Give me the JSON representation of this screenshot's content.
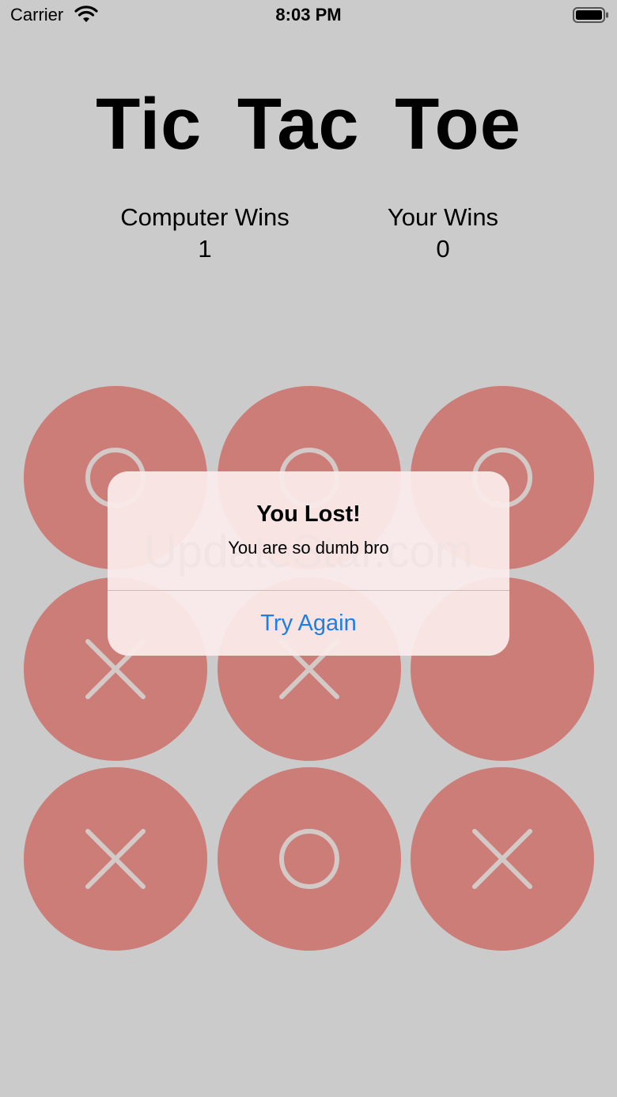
{
  "status_bar": {
    "carrier": "Carrier",
    "time": "8:03 PM",
    "wifi_icon": "wifi-icon",
    "battery_icon": "battery-icon"
  },
  "title": "Tic Tac Toe",
  "scores": {
    "computer": {
      "label": "Computer Wins",
      "value": "1"
    },
    "user": {
      "label": "Your Wins",
      "value": "0"
    }
  },
  "board": {
    "cell_color": "#cd7d77",
    "mark_color": "#d3c9c7",
    "cells": [
      "O",
      "O",
      "O",
      "X",
      "X",
      "",
      "X",
      "O",
      "X"
    ]
  },
  "alert": {
    "title": "You Lost!",
    "message": "You are so dumb bro",
    "button_label": "Try Again",
    "button_color": "#1a7fe8"
  },
  "watermark": "UpdateStar.com"
}
